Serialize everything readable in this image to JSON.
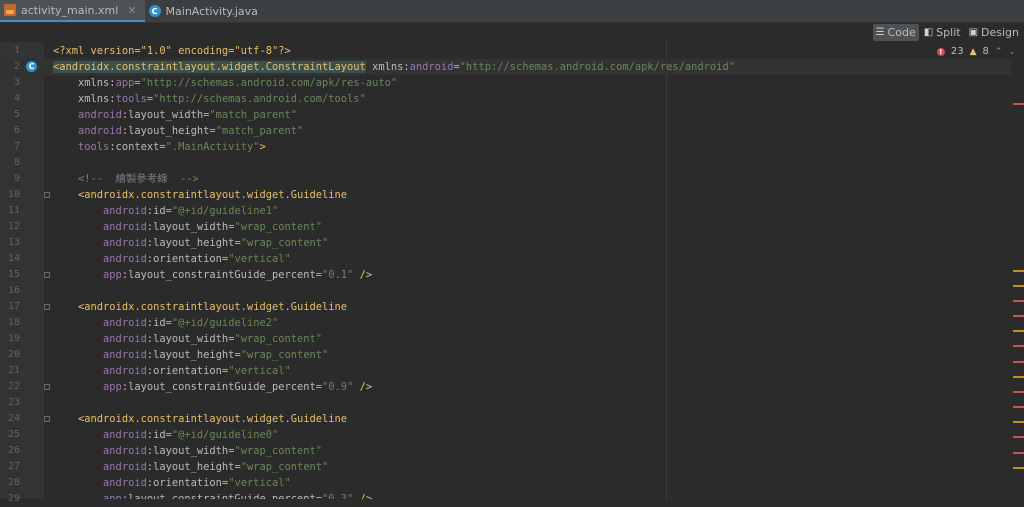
{
  "tabs": [
    {
      "label": "activity_main.xml",
      "close": "✕",
      "icon": "xml-file-icon",
      "active": true
    },
    {
      "label": "MainActivity.java",
      "icon": "java-class-icon",
      "active": false
    }
  ],
  "view_modes": [
    {
      "label": "Code",
      "icon": "code-view-icon",
      "active": true
    },
    {
      "label": "Split",
      "icon": "split-view-icon",
      "active": false
    },
    {
      "label": "Design",
      "icon": "design-view-icon",
      "active": false
    }
  ],
  "inspections": {
    "errors": "23",
    "warnings": "8"
  },
  "code_lines": [
    {
      "n": "1",
      "t": [
        [
          "tag",
          "<?xml version=\"1.0\" encoding=\"utf-8\"?>"
        ]
      ]
    },
    {
      "n": "2",
      "current": true,
      "badge": "C",
      "t": [
        [
          "taghl",
          "<androidx.constraintlayout.widget.ConstraintLayout"
        ],
        [
          "txt",
          " "
        ],
        [
          "attr",
          "xmlns:"
        ],
        [
          "ns",
          "android"
        ],
        [
          "txt",
          "="
        ],
        [
          "val",
          "\"http://schemas.android.com/apk/res/android\""
        ]
      ]
    },
    {
      "n": "3",
      "t": [
        [
          "txt",
          "    "
        ],
        [
          "attr",
          "xmlns:"
        ],
        [
          "ns",
          "app"
        ],
        [
          "txt",
          "="
        ],
        [
          "val",
          "\"http://schemas.android.com/apk/res-auto\""
        ]
      ]
    },
    {
      "n": "4",
      "t": [
        [
          "txt",
          "    "
        ],
        [
          "attr",
          "xmlns:"
        ],
        [
          "ns",
          "tools"
        ],
        [
          "txt",
          "="
        ],
        [
          "val",
          "\"http://schemas.android.com/tools\""
        ]
      ]
    },
    {
      "n": "5",
      "t": [
        [
          "txt",
          "    "
        ],
        [
          "ns",
          "android"
        ],
        [
          "attr",
          ":layout_width"
        ],
        [
          "txt",
          "="
        ],
        [
          "val",
          "\"match_parent\""
        ]
      ]
    },
    {
      "n": "6",
      "t": [
        [
          "txt",
          "    "
        ],
        [
          "ns",
          "android"
        ],
        [
          "attr",
          ":layout_height"
        ],
        [
          "txt",
          "="
        ],
        [
          "val",
          "\"match_parent\""
        ]
      ]
    },
    {
      "n": "7",
      "t": [
        [
          "txt",
          "    "
        ],
        [
          "ns",
          "tools"
        ],
        [
          "attr",
          ":context"
        ],
        [
          "txt",
          "="
        ],
        [
          "val",
          "\".MainActivity\""
        ],
        [
          "tag",
          ">"
        ]
      ]
    },
    {
      "n": "8",
      "t": []
    },
    {
      "n": "9",
      "t": [
        [
          "txt",
          "    "
        ],
        [
          "cmt",
          "<!--  繪製參考線  -->"
        ]
      ]
    },
    {
      "n": "10",
      "fold": true,
      "t": [
        [
          "txt",
          "    "
        ],
        [
          "tag",
          "<androidx.constraintlayout.widget.Guideline"
        ]
      ]
    },
    {
      "n": "11",
      "t": [
        [
          "txt",
          "        "
        ],
        [
          "ns",
          "android"
        ],
        [
          "attr",
          ":id"
        ],
        [
          "txt",
          "="
        ],
        [
          "val",
          "\"@+id/guideline1\""
        ]
      ]
    },
    {
      "n": "12",
      "t": [
        [
          "txt",
          "        "
        ],
        [
          "ns",
          "android"
        ],
        [
          "attr",
          ":layout_width"
        ],
        [
          "txt",
          "="
        ],
        [
          "val",
          "\"wrap_content\""
        ]
      ]
    },
    {
      "n": "13",
      "t": [
        [
          "txt",
          "        "
        ],
        [
          "ns",
          "android"
        ],
        [
          "attr",
          ":layout_height"
        ],
        [
          "txt",
          "="
        ],
        [
          "val",
          "\"wrap_content\""
        ]
      ]
    },
    {
      "n": "14",
      "t": [
        [
          "txt",
          "        "
        ],
        [
          "ns",
          "android"
        ],
        [
          "attr",
          ":orientation"
        ],
        [
          "txt",
          "="
        ],
        [
          "val",
          "\"vertical\""
        ]
      ]
    },
    {
      "n": "15",
      "fold": true,
      "t": [
        [
          "txt",
          "        "
        ],
        [
          "ns",
          "app"
        ],
        [
          "attr",
          ":layout_constraintGuide_percent"
        ],
        [
          "txt",
          "="
        ],
        [
          "val",
          "\"0.1\""
        ],
        [
          "txt",
          " "
        ],
        [
          "tag",
          "/>"
        ]
      ]
    },
    {
      "n": "16",
      "t": []
    },
    {
      "n": "17",
      "fold": true,
      "t": [
        [
          "txt",
          "    "
        ],
        [
          "tag",
          "<androidx.constraintlayout.widget.Guideline"
        ]
      ]
    },
    {
      "n": "18",
      "t": [
        [
          "txt",
          "        "
        ],
        [
          "ns",
          "android"
        ],
        [
          "attr",
          ":id"
        ],
        [
          "txt",
          "="
        ],
        [
          "val",
          "\"@+id/guideline2\""
        ]
      ]
    },
    {
      "n": "19",
      "t": [
        [
          "txt",
          "        "
        ],
        [
          "ns",
          "android"
        ],
        [
          "attr",
          ":layout_width"
        ],
        [
          "txt",
          "="
        ],
        [
          "val",
          "\"wrap_content\""
        ]
      ]
    },
    {
      "n": "20",
      "t": [
        [
          "txt",
          "        "
        ],
        [
          "ns",
          "android"
        ],
        [
          "attr",
          ":layout_height"
        ],
        [
          "txt",
          "="
        ],
        [
          "val",
          "\"wrap_content\""
        ]
      ]
    },
    {
      "n": "21",
      "t": [
        [
          "txt",
          "        "
        ],
        [
          "ns",
          "android"
        ],
        [
          "attr",
          ":orientation"
        ],
        [
          "txt",
          "="
        ],
        [
          "val",
          "\"vertical\""
        ]
      ]
    },
    {
      "n": "22",
      "fold": true,
      "t": [
        [
          "txt",
          "        "
        ],
        [
          "ns",
          "app"
        ],
        [
          "attr",
          ":layout_constraintGuide_percent"
        ],
        [
          "txt",
          "="
        ],
        [
          "val",
          "\"0.9\""
        ],
        [
          "txt",
          " "
        ],
        [
          "tag",
          "/>"
        ]
      ]
    },
    {
      "n": "23",
      "t": []
    },
    {
      "n": "24",
      "fold": true,
      "t": [
        [
          "txt",
          "    "
        ],
        [
          "tag",
          "<androidx.constraintlayout.widget.Guideline"
        ]
      ]
    },
    {
      "n": "25",
      "t": [
        [
          "txt",
          "        "
        ],
        [
          "ns",
          "android"
        ],
        [
          "attr",
          ":id"
        ],
        [
          "txt",
          "="
        ],
        [
          "val",
          "\"@+id/guideline0\""
        ]
      ]
    },
    {
      "n": "26",
      "t": [
        [
          "txt",
          "        "
        ],
        [
          "ns",
          "android"
        ],
        [
          "attr",
          ":layout_width"
        ],
        [
          "txt",
          "="
        ],
        [
          "val",
          "\"wrap_content\""
        ]
      ]
    },
    {
      "n": "27",
      "t": [
        [
          "txt",
          "        "
        ],
        [
          "ns",
          "android"
        ],
        [
          "attr",
          ":layout_height"
        ],
        [
          "txt",
          "="
        ],
        [
          "val",
          "\"wrap_content\""
        ]
      ]
    },
    {
      "n": "28",
      "t": [
        [
          "txt",
          "        "
        ],
        [
          "ns",
          "android"
        ],
        [
          "attr",
          ":orientation"
        ],
        [
          "txt",
          "="
        ],
        [
          "val",
          "\"vertical\""
        ]
      ]
    },
    {
      "n": "29",
      "t": [
        [
          "txt",
          "        "
        ],
        [
          "ns",
          "app"
        ],
        [
          "attr",
          ":layout_constraintGuide_percent"
        ],
        [
          "txt",
          "="
        ],
        [
          "val",
          "\"0.3\""
        ],
        [
          "txt",
          " "
        ],
        [
          "tag",
          "/>"
        ]
      ]
    }
  ],
  "colors": {
    "background": "#2b2b2b",
    "gutter": "#313335",
    "tag": "#e8bf6a",
    "namespace": "#9876aa",
    "value": "#6a8759",
    "comment": "#808080",
    "error_mark": "#c75450",
    "warning_mark": "#be9117",
    "accent": "#4a88c7"
  },
  "error_stripe": {
    "marks": [
      {
        "kind": "error",
        "line": 4
      },
      {
        "kind": "warning",
        "line": 15
      },
      {
        "kind": "warning",
        "line": 16
      },
      {
        "kind": "error",
        "line": 17
      },
      {
        "kind": "error",
        "line": 18
      },
      {
        "kind": "warning",
        "line": 19
      },
      {
        "kind": "error",
        "line": 20
      },
      {
        "kind": "error",
        "line": 21
      },
      {
        "kind": "warning",
        "line": 22
      },
      {
        "kind": "error",
        "line": 23
      },
      {
        "kind": "error",
        "line": 24
      },
      {
        "kind": "warning",
        "line": 25
      },
      {
        "kind": "error",
        "line": 26
      },
      {
        "kind": "error",
        "line": 27
      },
      {
        "kind": "warning",
        "line": 28
      }
    ]
  }
}
